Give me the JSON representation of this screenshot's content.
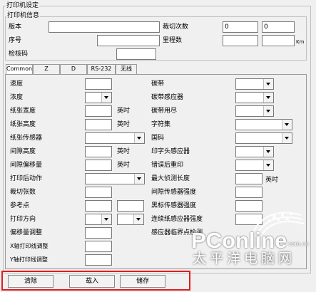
{
  "printer_settings": {
    "title": "打印机设定"
  },
  "printer_info": {
    "title": "打印机信息",
    "version_label": "版本",
    "version_value": "",
    "serial_label": "序号",
    "serial_value": "",
    "checksum_label": "检核码",
    "checksum_value": "",
    "cut_count_label": "裁切次数",
    "cut_count_value1": "0",
    "cut_count_value2": "0",
    "mileage_label": "里程数",
    "mileage_unit": "Km"
  },
  "tabs": [
    {
      "label": "Common"
    },
    {
      "label": "Z"
    },
    {
      "label": "D"
    },
    {
      "label": "RS-232"
    },
    {
      "label": "无线"
    }
  ],
  "common": {
    "left": [
      {
        "label": "速度"
      },
      {
        "label": "浓度"
      },
      {
        "label": "纸张宽度",
        "unit": "英吋"
      },
      {
        "label": "纸张高度",
        "unit": "英吋"
      },
      {
        "label": "纸张传感器"
      },
      {
        "label": "间隙高度",
        "unit": "英吋"
      },
      {
        "label": "间隙偏移量",
        "unit": "英吋"
      },
      {
        "label": "打印后动作"
      },
      {
        "label": "裁切张数"
      },
      {
        "label": "参考点"
      },
      {
        "label": "打印方向"
      },
      {
        "label": "偏移量调整"
      },
      {
        "label": "X轴打印线调整"
      },
      {
        "label": "Y轴打印线调整"
      }
    ],
    "right": [
      {
        "label": "碳带"
      },
      {
        "label": "碳带感应器"
      },
      {
        "label": "碳带用尽"
      },
      {
        "label": "字符集"
      },
      {
        "label": "国码"
      },
      {
        "label": "印字头感应器"
      },
      {
        "label": "错误后重印"
      },
      {
        "label": "最大侦测长度",
        "unit": "英吋"
      },
      {
        "label": "间隙传感器强度"
      },
      {
        "label": "黑标传感器强度"
      },
      {
        "label": "连续纸感应器强度"
      },
      {
        "label": "感应器临界点检测"
      }
    ]
  },
  "buttons": {
    "clear": "清除",
    "load": "载入",
    "save": "储存"
  },
  "watermark": {
    "brand": "PConline",
    "domain": "com.cn",
    "chinese": "太平洋电脑网"
  }
}
